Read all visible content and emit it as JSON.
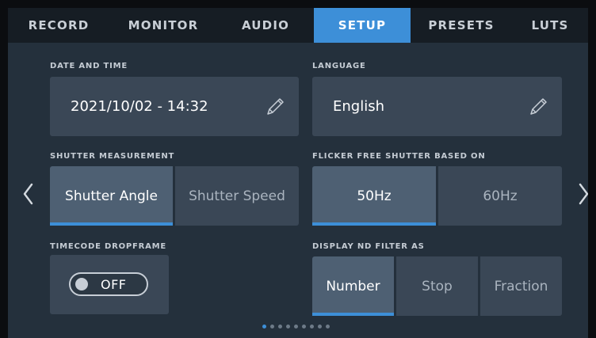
{
  "tabs": [
    {
      "label": "RECORD"
    },
    {
      "label": "MONITOR"
    },
    {
      "label": "AUDIO"
    },
    {
      "label": "SETUP",
      "active": true
    },
    {
      "label": "PRESETS"
    },
    {
      "label": "LUTS"
    }
  ],
  "date_time": {
    "label": "DATE AND TIME",
    "value": "2021/10/02 - 14:32",
    "icon": "pencil-icon"
  },
  "language": {
    "label": "LANGUAGE",
    "value": "English",
    "icon": "pencil-icon"
  },
  "shutter_measurement": {
    "label": "SHUTTER MEASUREMENT",
    "options": [
      "Shutter Angle",
      "Shutter Speed"
    ],
    "selected": "Shutter Angle"
  },
  "flicker_free": {
    "label": "FLICKER FREE SHUTTER BASED ON",
    "options": [
      "50Hz",
      "60Hz"
    ],
    "selected": "50Hz"
  },
  "timecode_dropframe": {
    "label": "TIMECODE DROPFRAME",
    "value": "OFF"
  },
  "nd_filter": {
    "label": "DISPLAY ND FILTER AS",
    "options": [
      "Number",
      "Stop",
      "Fraction"
    ],
    "selected": "Number"
  },
  "pagination": {
    "pages": 9,
    "current": 1
  },
  "colors": {
    "accent": "#3d8fd8",
    "panel": "#3a4756",
    "background": "#24303c"
  }
}
